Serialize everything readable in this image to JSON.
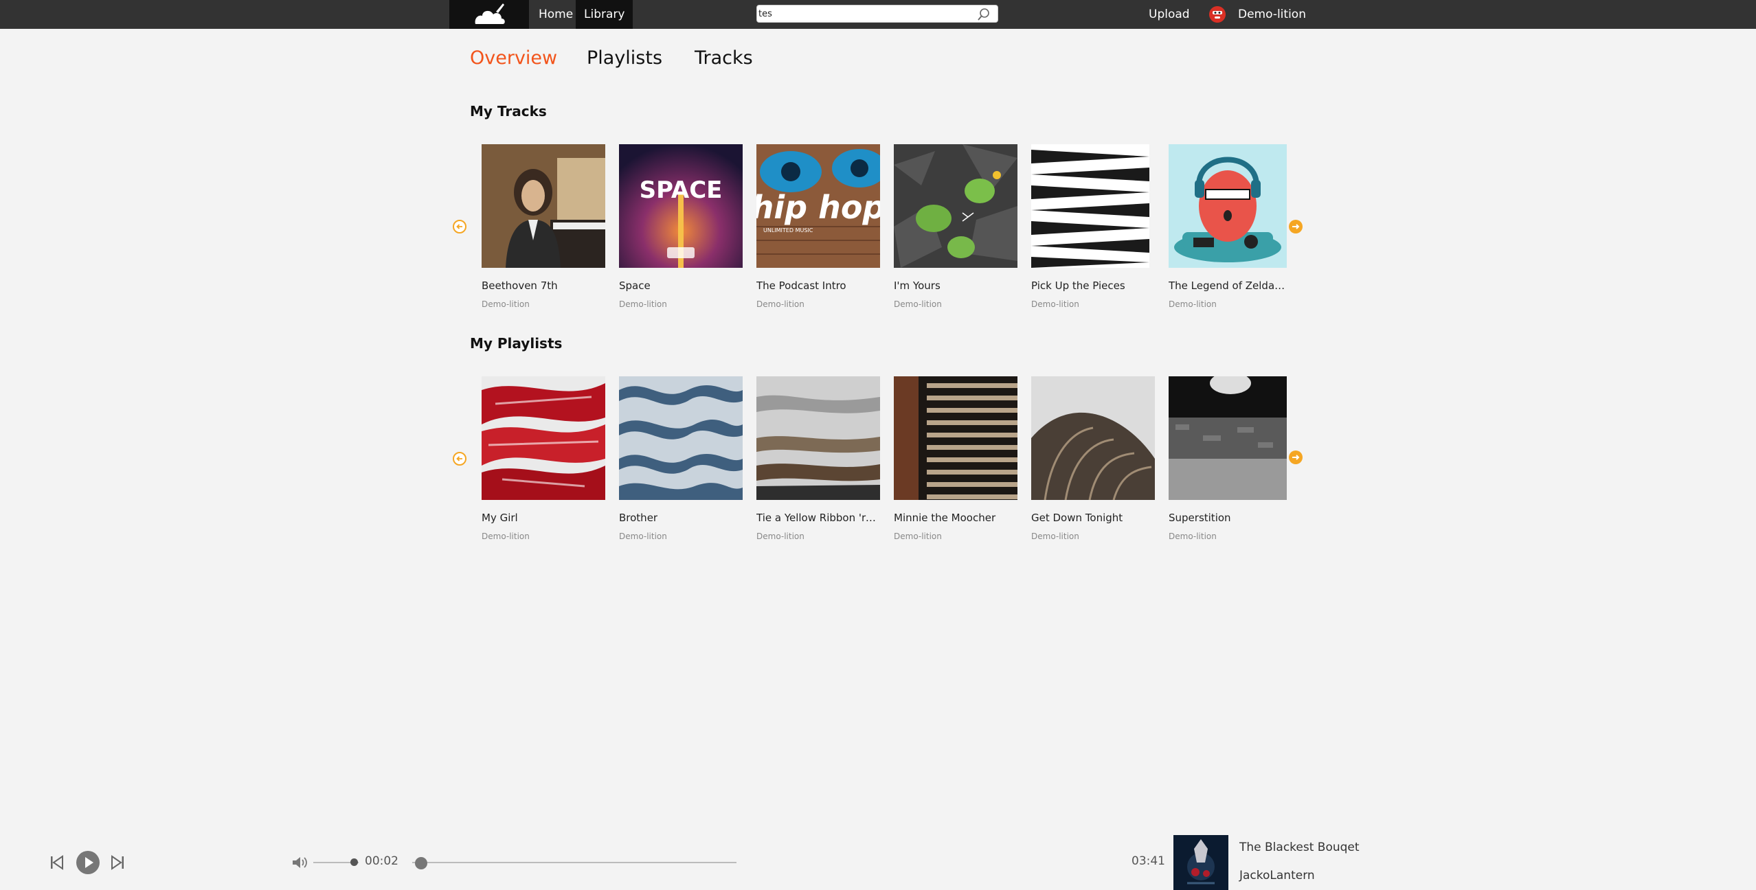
{
  "header": {
    "nav": [
      {
        "label": "Home"
      },
      {
        "label": "Library"
      }
    ],
    "search_value": "tes",
    "upload_label": "Upload",
    "user_name": "Demo-lition"
  },
  "tabs": [
    {
      "label": "Overview",
      "active": true
    },
    {
      "label": "Playlists",
      "active": false
    },
    {
      "label": "Tracks",
      "active": false
    }
  ],
  "my_tracks": {
    "title": "My Tracks",
    "items": [
      {
        "title": "Beethoven 7th",
        "artist": "Demo-lition"
      },
      {
        "title": "Space",
        "artist": "Demo-lition",
        "art_text": "SPACE"
      },
      {
        "title": "The Podcast Intro",
        "artist": "Demo-lition",
        "art_text": "hip hop",
        "art_subtext": "UNLIMITED MUSIC"
      },
      {
        "title": "I'm Yours",
        "artist": "Demo-lition"
      },
      {
        "title": "Pick Up the Pieces",
        "artist": "Demo-lition"
      },
      {
        "title": "The Legend of Zelda - G...",
        "artist": "Demo-lition"
      }
    ]
  },
  "my_playlists": {
    "title": "My Playlists",
    "items": [
      {
        "title": "My Girl",
        "artist": "Demo-lition"
      },
      {
        "title": "Brother",
        "artist": "Demo-lition"
      },
      {
        "title": "Tie a Yellow Ribbon 'rou...",
        "artist": "Demo-lition"
      },
      {
        "title": "Minnie the Moocher",
        "artist": "Demo-lition"
      },
      {
        "title": "Get Down Tonight",
        "artist": "Demo-lition"
      },
      {
        "title": "Superstition",
        "artist": "Demo-lition"
      }
    ]
  },
  "player": {
    "current_time": "00:02",
    "duration": "03:41",
    "progress_fraction": 0.01,
    "volume_fraction": 0.9,
    "now_playing_title": "The Blackest Bouqet",
    "now_playing_artist": "JackoLantern"
  },
  "colors": {
    "accent": "#f2541b",
    "arrow": "#f5a623",
    "topbar": "#333333"
  },
  "icons": [
    "cloud-logo-icon",
    "search-icon",
    "avatar",
    "chevron-left-icon",
    "chevron-right-icon",
    "previous-icon",
    "play-icon",
    "next-icon",
    "volume-icon"
  ]
}
